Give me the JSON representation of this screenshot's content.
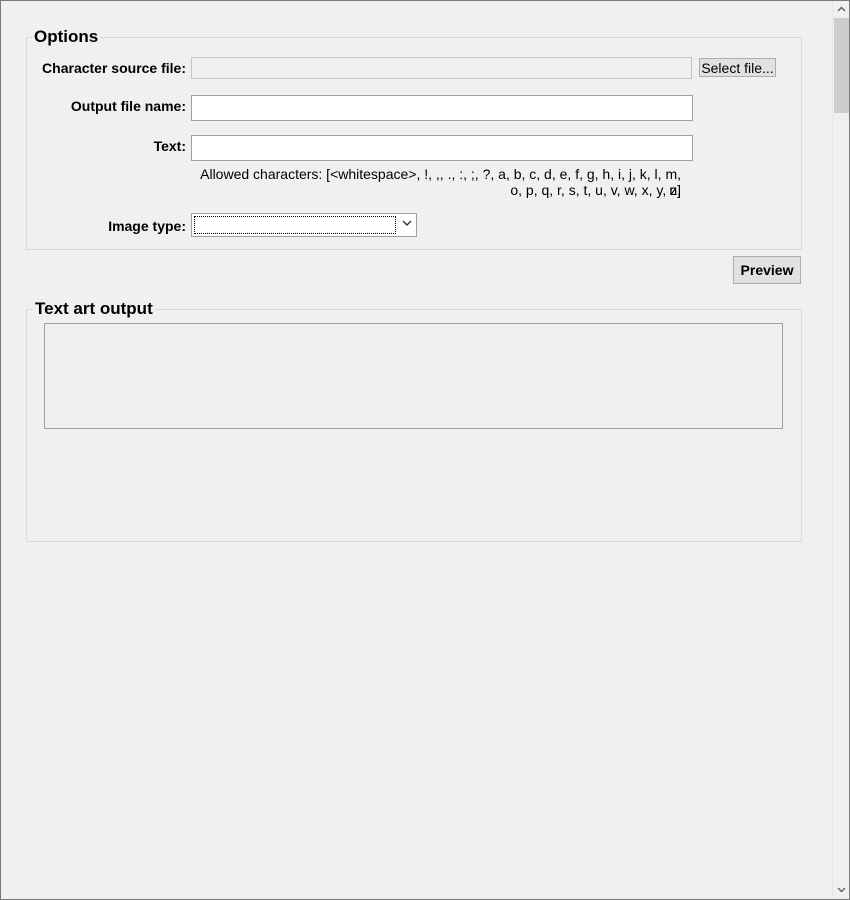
{
  "options": {
    "legend": "Options",
    "character_source_label": "Character source file:",
    "character_source_value": "",
    "select_file_label": "Select file...",
    "output_file_label": "Output file name:",
    "output_file_value": "",
    "text_label": "Text:",
    "text_value": "",
    "allowed_line1": "Allowed characters: [<whitespace>, !, ,, ., :, ;, ?, a, b, c, d, e, f, g, h, i, j, k, l, m, n,",
    "allowed_line2": "o, p, q, r, s, t, u, v, w, x, y, z]",
    "image_type_label": "Image type:",
    "image_type_value": ""
  },
  "preview_label": "Preview",
  "output": {
    "legend": "Text art output",
    "content": ""
  },
  "icons": {
    "dropdown": "chevron-down-icon",
    "scroll_up": "arrow-up-icon",
    "scroll_down": "arrow-down-icon"
  }
}
